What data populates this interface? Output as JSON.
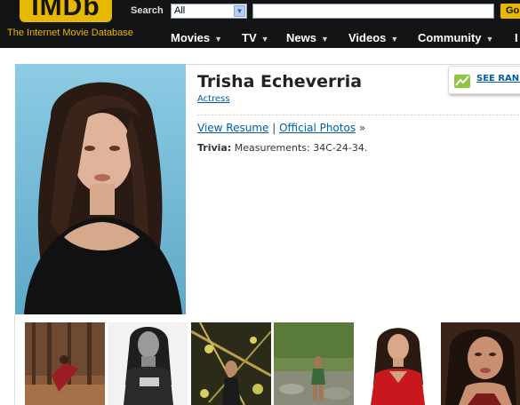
{
  "header": {
    "logo_text": "IMDb",
    "tagline": "The Internet Movie Database",
    "search_label": "Search",
    "search_scope": "All",
    "go_label": "Go",
    "nav": [
      {
        "label": "Movies"
      },
      {
        "label": "TV"
      },
      {
        "label": "News"
      },
      {
        "label": "Videos"
      },
      {
        "label": "Community"
      },
      {
        "label": "I"
      }
    ],
    "brand_color": "#e6b800"
  },
  "profile": {
    "name": "Trisha Echeverria",
    "role": "Actress",
    "see_rank_label": "SEE RANK",
    "links": {
      "resume": "View Resume",
      "separator": "|",
      "photos": "Official Photos",
      "arrow": "»"
    },
    "trivia_label": "Trivia:",
    "trivia_text": "Measurements: 34C-24-34."
  },
  "thumbnails": [
    {
      "icon": "photo-forest-pose"
    },
    {
      "icon": "photo-bw-portrait"
    },
    {
      "icon": "photo-vines"
    },
    {
      "icon": "photo-creek"
    },
    {
      "icon": "photo-red-top"
    },
    {
      "icon": "photo-closeup"
    }
  ]
}
